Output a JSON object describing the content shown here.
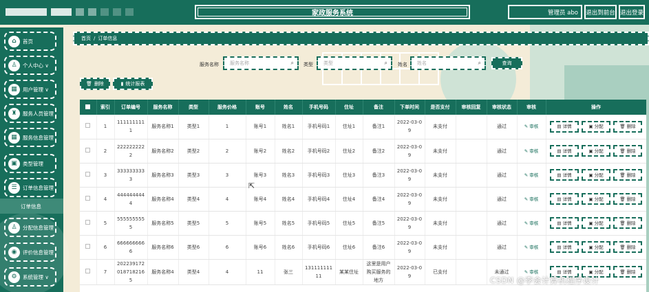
{
  "app": {
    "title": "家政服务系统",
    "user_label": "管理员 abo",
    "front_label": "退出到前台",
    "logout_label": "退出登录"
  },
  "sidebar": {
    "items": [
      {
        "label": "首页",
        "icon": "home-icon",
        "glyph": "⌂"
      },
      {
        "label": "个人中心 ∨",
        "icon": "user-icon",
        "glyph": "♙"
      },
      {
        "label": "用户管理 ∨",
        "icon": "grid-icon",
        "glyph": "▦"
      },
      {
        "label": "服务人员管理",
        "icon": "staff-icon",
        "glyph": "♜"
      },
      {
        "label": "服务信息管理",
        "icon": "grid-icon",
        "glyph": "▦"
      },
      {
        "label": "类型管理",
        "icon": "box-icon",
        "glyph": "▣"
      },
      {
        "label": "订单信息管理",
        "icon": "list-icon",
        "glyph": "☰"
      },
      {
        "label": "分配信息管理",
        "icon": "user-icon",
        "glyph": "♙"
      },
      {
        "label": "评价信息管理",
        "icon": "marker-icon",
        "glyph": "◉"
      },
      {
        "label": "系统管理 ∨",
        "icon": "gear-icon",
        "glyph": "⚙"
      }
    ],
    "active_sub": "订单信息"
  },
  "breadcrumb": {
    "home": "首页",
    "separator": "/",
    "current": "订单信息"
  },
  "search": {
    "service_label": "服务名称",
    "service_placeholder": "服务名称",
    "type_label": "类型",
    "type_placeholder": "类型",
    "name_label": "姓名",
    "name_placeholder": "姓名",
    "query_button": "查询"
  },
  "actions": {
    "delete": "删除",
    "report": "统计报表"
  },
  "table": {
    "columns": [
      "索引",
      "订单编号",
      "服务名称",
      "类型",
      "服务价格",
      "账号",
      "姓名",
      "手机号码",
      "住址",
      "备注",
      "下单时间",
      "是否支付",
      "审核回复",
      "审核状态",
      "审核",
      "操作"
    ],
    "audit_link": "审核",
    "op_buttons": [
      "详情",
      "分配",
      "删除"
    ],
    "rows": [
      {
        "idx": "1",
        "order": "1111111111",
        "service": "服务名称1",
        "type": "类型1",
        "price": "1",
        "account": "账号1",
        "name": "姓名1",
        "phone": "手机号码1",
        "addr": "住址1",
        "note": "备注1",
        "time": "2022-03-09",
        "paid": "未支付",
        "reply": "",
        "status": "通过"
      },
      {
        "idx": "2",
        "order": "2222222222",
        "service": "服务名称2",
        "type": "类型2",
        "price": "2",
        "account": "账号2",
        "name": "姓名2",
        "phone": "手机号码2",
        "addr": "住址2",
        "note": "备注2",
        "time": "2022-03-09",
        "paid": "未支付",
        "reply": "",
        "status": "通过"
      },
      {
        "idx": "3",
        "order": "3333333333",
        "service": "服务名称3",
        "type": "类型3",
        "price": "3",
        "account": "账号3",
        "name": "姓名3",
        "phone": "手机号码3",
        "addr": "住址3",
        "note": "备注3",
        "time": "2022-03-09",
        "paid": "未支付",
        "reply": "",
        "status": "通过"
      },
      {
        "idx": "4",
        "order": "4444444444",
        "service": "服务名称4",
        "type": "类型4",
        "price": "4",
        "account": "账号4",
        "name": "姓名4",
        "phone": "手机号码4",
        "addr": "住址4",
        "note": "备注4",
        "time": "2022-03-09",
        "paid": "未支付",
        "reply": "",
        "status": "通过"
      },
      {
        "idx": "5",
        "order": "5555555555",
        "service": "服务名称5",
        "type": "类型5",
        "price": "5",
        "account": "账号5",
        "name": "姓名5",
        "phone": "手机号码5",
        "addr": "住址5",
        "note": "备注5",
        "time": "2022-03-09",
        "paid": "未支付",
        "reply": "",
        "status": "通过"
      },
      {
        "idx": "6",
        "order": "6666666666",
        "service": "服务名称6",
        "type": "类型6",
        "price": "6",
        "account": "账号6",
        "name": "姓名6",
        "phone": "手机号码6",
        "addr": "住址6",
        "note": "备注6",
        "time": "2022-03-09",
        "paid": "未支付",
        "reply": "",
        "status": "通过"
      },
      {
        "idx": "7",
        "order": "2022391720187182165",
        "service": "服务名称4",
        "type": "类型4",
        "price": "4",
        "account": "11",
        "name": "张三",
        "phone": "13111111111",
        "addr": "某某住址",
        "note": "这里是用户购买服务的地方",
        "time": "2022-03-09",
        "paid": "已支付",
        "reply": "",
        "status": "未通过"
      }
    ]
  },
  "watermark": "CSDN @李会计算机程序设计",
  "colors": {
    "primary": "#176e5b",
    "background": "#f4ecd8"
  }
}
